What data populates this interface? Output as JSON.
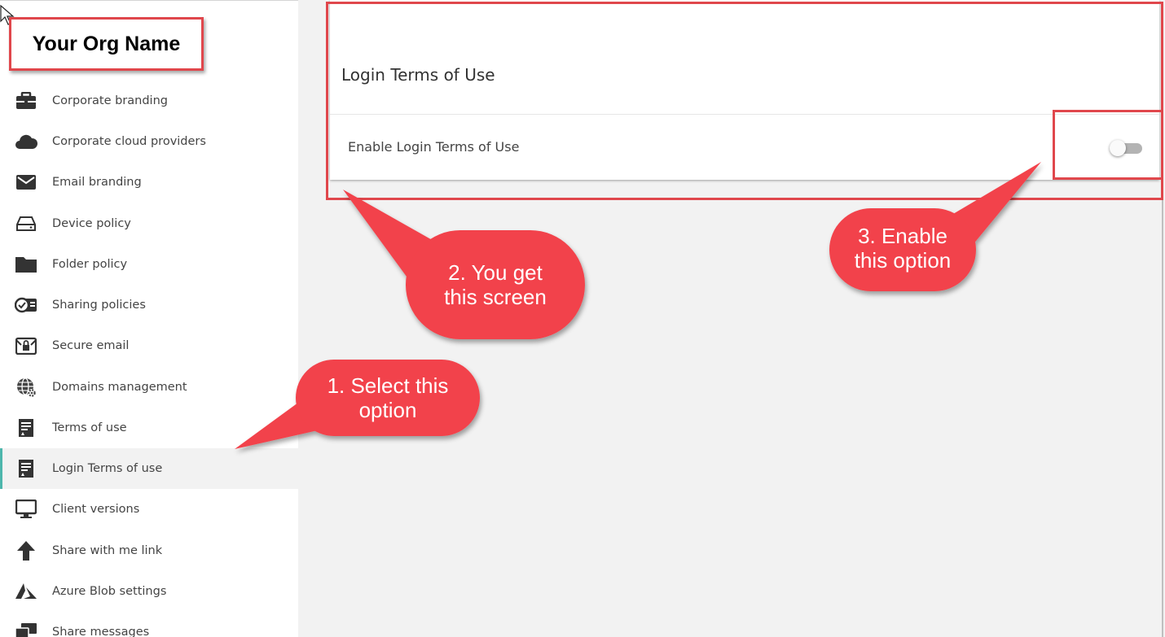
{
  "sidebar": {
    "org_name": "Your Org Name",
    "items": [
      {
        "label": "Corporate branding",
        "icon": "briefcase-icon"
      },
      {
        "label": "Corporate cloud providers",
        "icon": "cloud-icon"
      },
      {
        "label": "Email branding",
        "icon": "envelope-icon"
      },
      {
        "label": "Device policy",
        "icon": "hard-drive-icon"
      },
      {
        "label": "Folder policy",
        "icon": "folder-icon"
      },
      {
        "label": "Sharing policies",
        "icon": "share-card-icon"
      },
      {
        "label": "Secure email",
        "icon": "lock-mail-icon"
      },
      {
        "label": "Domains management",
        "icon": "globe-gear-icon"
      },
      {
        "label": "Terms of use",
        "icon": "document-icon"
      },
      {
        "label": "Login Terms of use",
        "icon": "document-icon",
        "active": true
      },
      {
        "label": "Client versions",
        "icon": "monitor-icon"
      },
      {
        "label": "Share with me link",
        "icon": "arrow-up-icon"
      },
      {
        "label": "Azure Blob settings",
        "icon": "azure-icon"
      },
      {
        "label": "Share messages",
        "icon": "messages-icon"
      }
    ]
  },
  "panel": {
    "title": "Login Terms of Use",
    "setting_label": "Enable Login Terms of Use",
    "toggle_enabled": false
  },
  "callouts": {
    "step1_line1": "1. Select this",
    "step1_line2": "option",
    "step2_line1": "2. You get",
    "step2_line2": "this screen",
    "step3_line1": "3. Enable",
    "step3_line2": "this option"
  },
  "colors": {
    "highlight_red": "#e0474c",
    "callout_red": "#f2434b",
    "active_accent": "#4db6ac",
    "toggle_track": "#b3b3b3",
    "background": "#f2f2f2"
  }
}
